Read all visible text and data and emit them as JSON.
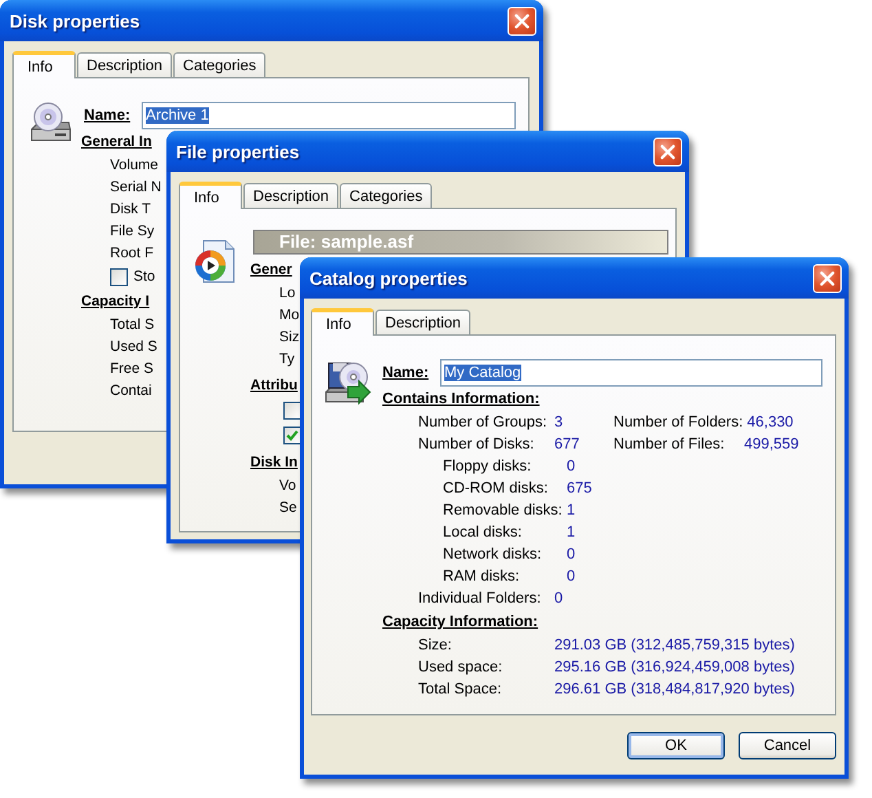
{
  "disk_properties": {
    "title": "Disk properties",
    "tabs": [
      {
        "label": "Info",
        "selected": true
      },
      {
        "label": "Description",
        "selected": false
      },
      {
        "label": "Categories",
        "selected": false
      }
    ],
    "name_field": {
      "label": "Name:",
      "value": "Archive 1",
      "text_selected": true
    },
    "sections": [
      {
        "heading": "General In",
        "items": [
          {
            "kind": "text",
            "label": "Volume"
          },
          {
            "kind": "text",
            "label": "Serial N"
          },
          {
            "kind": "text",
            "label": "Disk T"
          },
          {
            "kind": "text",
            "label": "File Sy"
          },
          {
            "kind": "text",
            "label": "Root F"
          },
          {
            "kind": "checkbox",
            "label": "Sto",
            "checked": false
          }
        ]
      },
      {
        "heading": "Capacity I",
        "items": [
          {
            "kind": "text",
            "label": "Total S"
          },
          {
            "kind": "text",
            "label": "Used S"
          },
          {
            "kind": "text",
            "label": "Free S"
          },
          {
            "kind": "text",
            "label": "Contai"
          }
        ]
      }
    ]
  },
  "file_properties": {
    "title": "File properties",
    "tabs": [
      {
        "label": "Info",
        "selected": true
      },
      {
        "label": "Description",
        "selected": false
      },
      {
        "label": "Categories",
        "selected": false
      }
    ],
    "banner": "File: sample.asf",
    "sections": [
      {
        "heading": "Gener",
        "items": [
          {
            "kind": "text",
            "label": "Lo"
          },
          {
            "kind": "text",
            "label": "Mo"
          },
          {
            "kind": "text",
            "label": "Siz"
          },
          {
            "kind": "text",
            "label": "Ty"
          }
        ]
      },
      {
        "heading": "Attribu",
        "items": [
          {
            "kind": "checkbox",
            "checked": false
          },
          {
            "kind": "checkbox",
            "checked": true
          }
        ]
      },
      {
        "heading": "Disk In",
        "items": [
          {
            "kind": "text",
            "label": "Vo"
          },
          {
            "kind": "text",
            "label": "Se"
          }
        ]
      }
    ]
  },
  "catalog_properties": {
    "title": "Catalog properties",
    "tabs": [
      {
        "label": "Info",
        "selected": true
      },
      {
        "label": "Description",
        "selected": false
      }
    ],
    "name_field": {
      "label": "Name:",
      "value": "My Catalog",
      "text_selected": true
    },
    "contains": {
      "heading": "Contains Information:",
      "rows": [
        {
          "kind": "main",
          "label": "Number of Groups:",
          "value": "3",
          "label_2": "Number of Folders:",
          "value_2": "46,330"
        },
        {
          "kind": "main",
          "label": "Number of Disks:",
          "value": "677",
          "label_2": "Number of Files:",
          "value_2": "499,559"
        },
        {
          "kind": "sub",
          "label": "Floppy disks:",
          "value": "0"
        },
        {
          "kind": "sub",
          "label": "CD-ROM disks:",
          "value": "675"
        },
        {
          "kind": "sub",
          "label": "Removable disks:",
          "value": "1"
        },
        {
          "kind": "sub",
          "label": "Local disks:",
          "value": "1"
        },
        {
          "kind": "sub",
          "label": "Network disks:",
          "value": "0"
        },
        {
          "kind": "sub",
          "label": "RAM disks:",
          "value": "0"
        },
        {
          "kind": "main",
          "label": "Individual Folders:",
          "value": "0"
        }
      ]
    },
    "capacity": {
      "heading": "Capacity Information:",
      "rows": [
        {
          "label": "Size:",
          "value": "291.03 GB (312,485,759,315 bytes)"
        },
        {
          "label": "Used space:",
          "value": "295.16 GB (316,924,459,008 bytes)"
        },
        {
          "label": "Total Space:",
          "value": "296.61 GB (318,484,817,920 bytes)"
        }
      ]
    },
    "buttons": [
      {
        "label": "OK",
        "default": true
      },
      {
        "label": "Cancel",
        "default": false
      }
    ]
  }
}
